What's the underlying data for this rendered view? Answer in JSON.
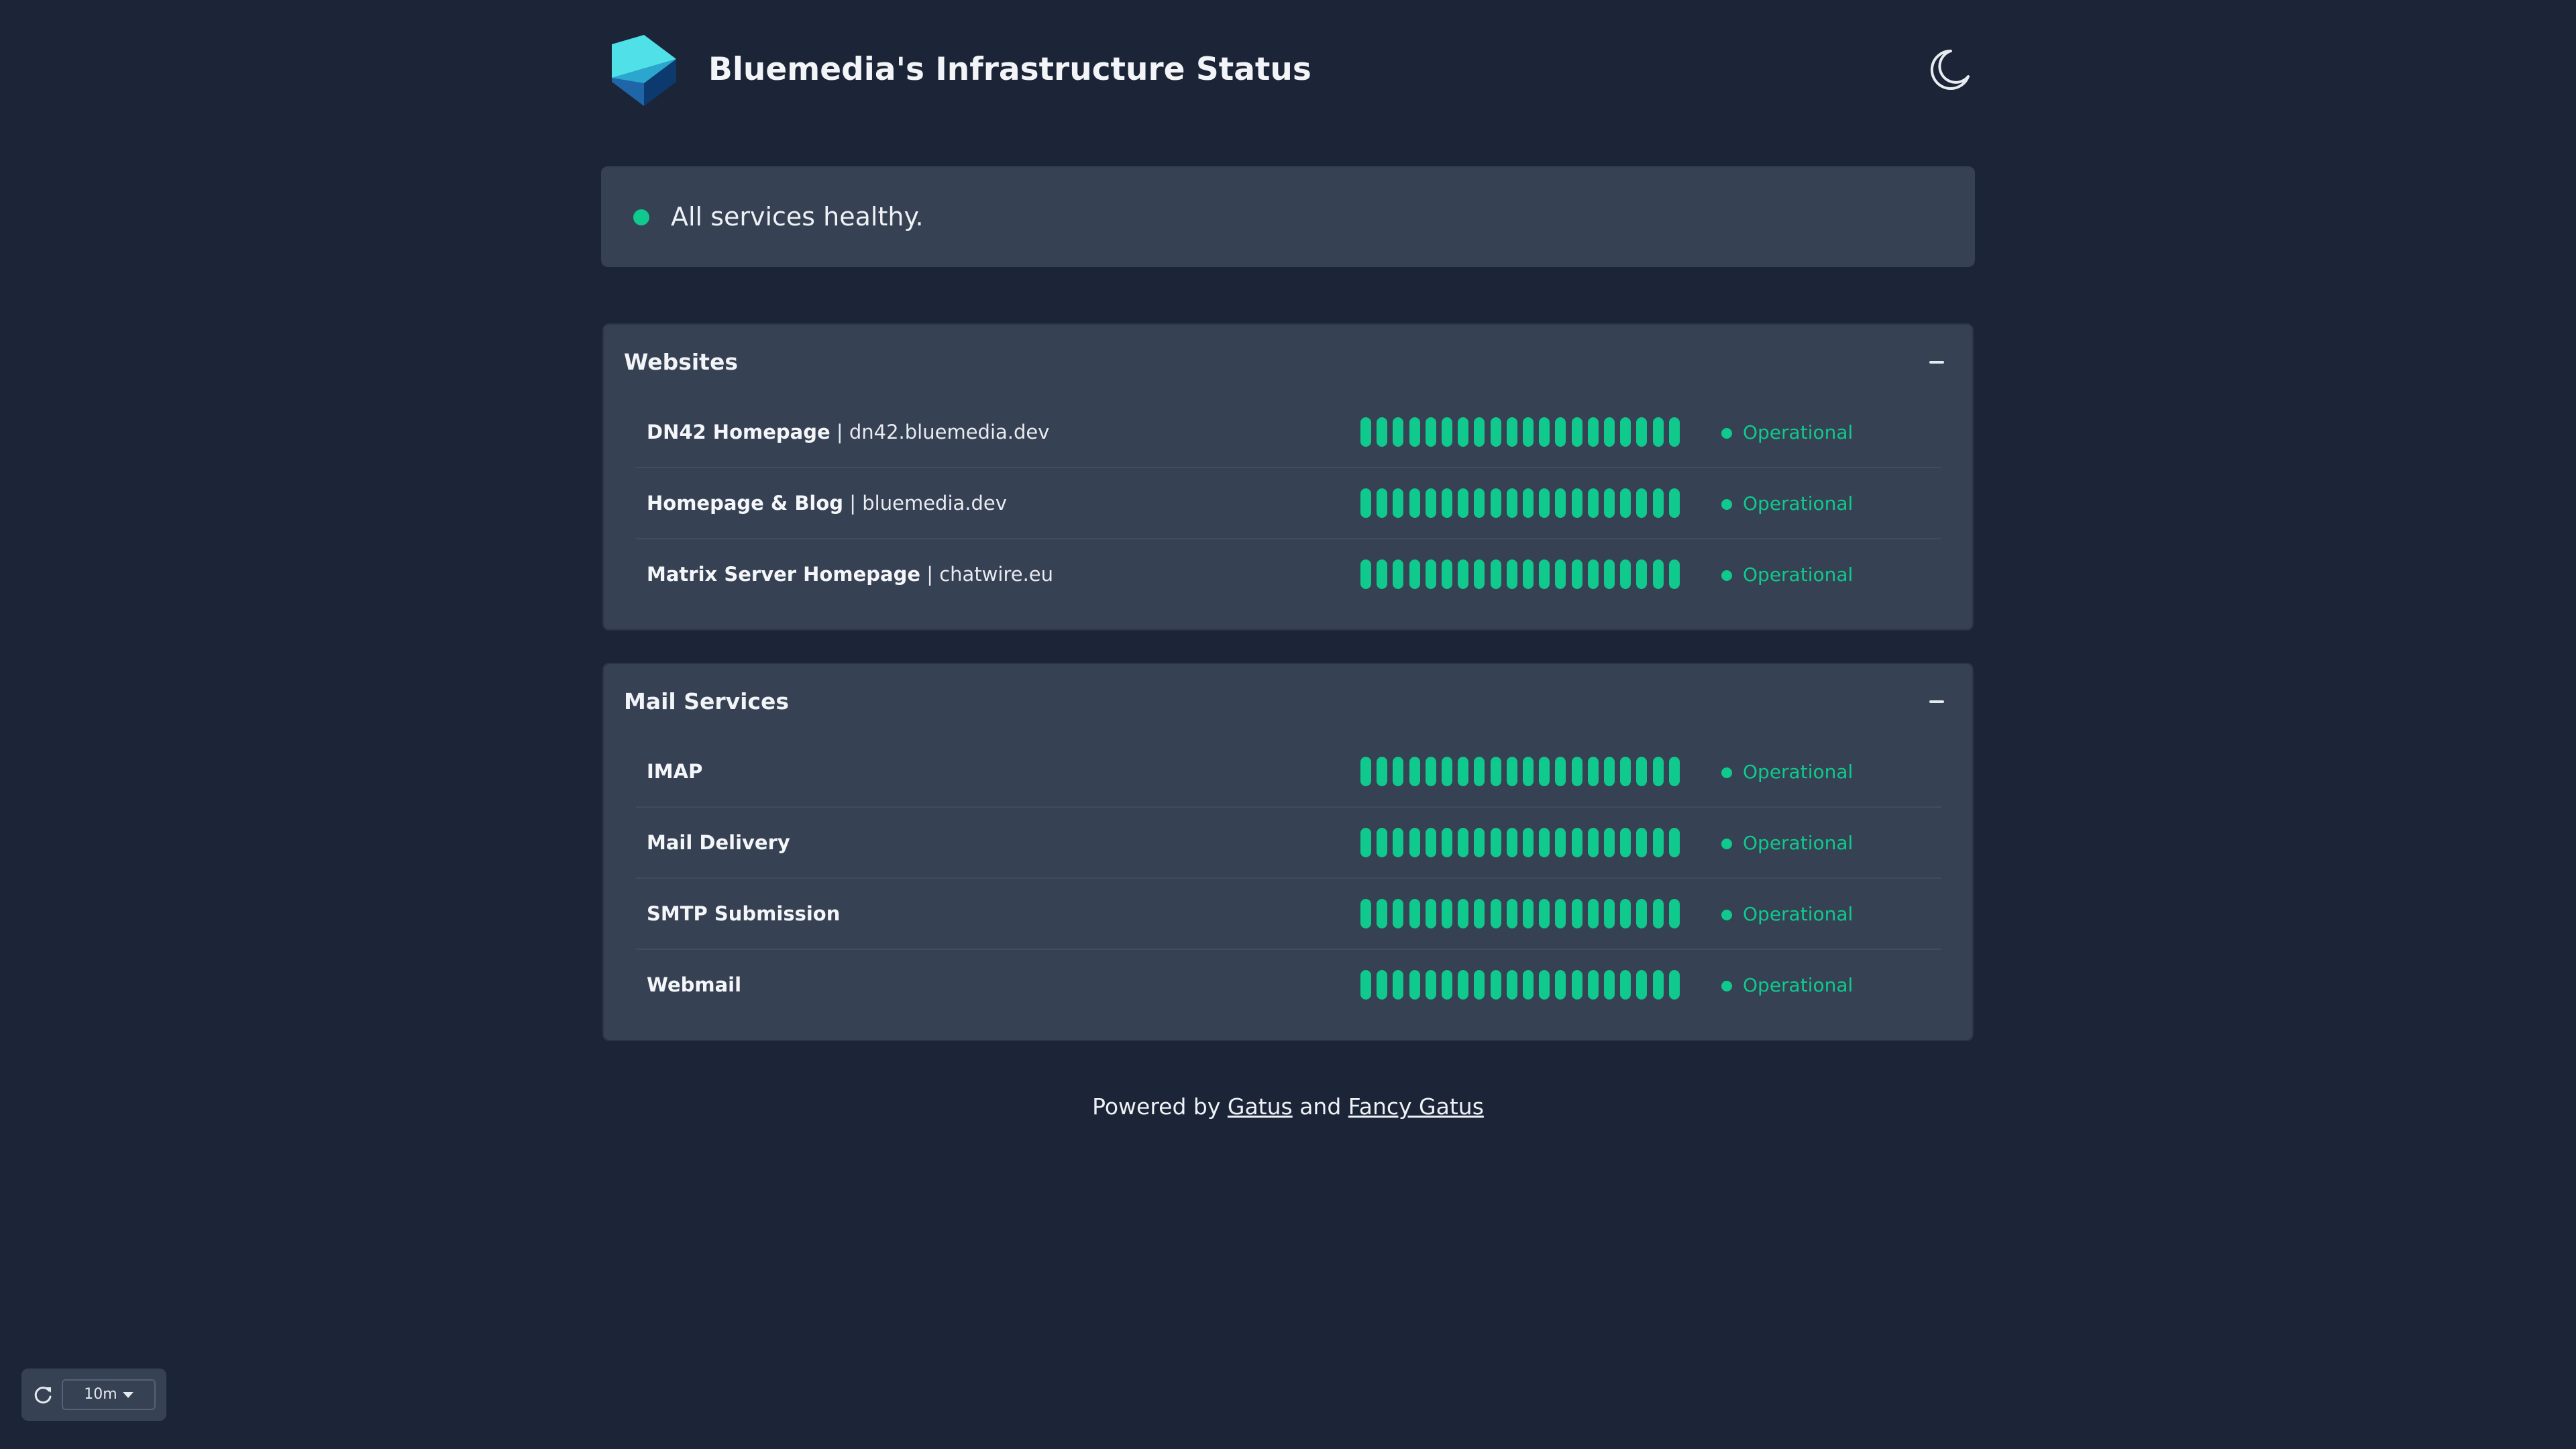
{
  "header": {
    "title": "Bluemedia's Infrastructure Status",
    "logo_icon": "bluemedia-logo-icon",
    "theme_icon": "moon-icon"
  },
  "status": {
    "text": "All services healthy.",
    "color": "#10c98c"
  },
  "colors": {
    "healthy": "#10c98c",
    "panel": "#364153",
    "background": "#1c2537"
  },
  "groups": [
    {
      "title": "Websites",
      "collapse_icon": "minus-icon",
      "endpoints": [
        {
          "name": "DN42 Homepage",
          "separator": " | ",
          "host": "dn42.bluemedia.dev",
          "status": "Operational",
          "healthy_checks": 20,
          "total_checks": 20
        },
        {
          "name": "Homepage & Blog",
          "separator": " | ",
          "host": "bluemedia.dev",
          "status": "Operational",
          "healthy_checks": 20,
          "total_checks": 20
        },
        {
          "name": "Matrix Server Homepage",
          "separator": " | ",
          "host": "chatwire.eu",
          "status": "Operational",
          "healthy_checks": 20,
          "total_checks": 20
        }
      ]
    },
    {
      "title": "Mail Services",
      "collapse_icon": "minus-icon",
      "endpoints": [
        {
          "name": "IMAP",
          "separator": "",
          "host": "",
          "status": "Operational",
          "healthy_checks": 20,
          "total_checks": 20
        },
        {
          "name": "Mail Delivery",
          "separator": "",
          "host": "",
          "status": "Operational",
          "healthy_checks": 20,
          "total_checks": 20
        },
        {
          "name": "SMTP Submission",
          "separator": "",
          "host": "",
          "status": "Operational",
          "healthy_checks": 20,
          "total_checks": 20
        },
        {
          "name": "Webmail",
          "separator": "",
          "host": "",
          "status": "Operational",
          "healthy_checks": 20,
          "total_checks": 20
        }
      ]
    }
  ],
  "footer": {
    "prefix": "Powered by ",
    "link1": "Gatus",
    "middle": " and ",
    "link2": "Fancy Gatus"
  },
  "refresh": {
    "icon": "refresh-icon",
    "interval": "10m"
  }
}
